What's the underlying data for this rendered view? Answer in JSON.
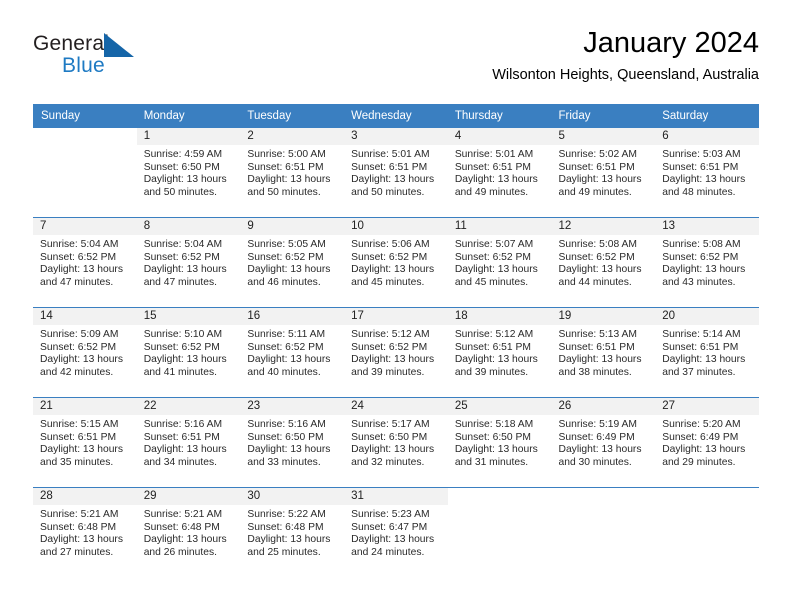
{
  "logo": {
    "word_one": "General",
    "word_two": "Blue",
    "flag_icon": "blue-triangle-flag-icon",
    "brand_blue": "#1e7ac3",
    "brand_dark": "#231f20"
  },
  "header": {
    "month_title": "January 2024",
    "location": "Wilsonton Heights, Queensland, Australia"
  },
  "theme": {
    "header_blue": "#3a7fc1",
    "daynum_band": "#f2f2f2",
    "text": "#000000"
  },
  "calendar": {
    "weekday_headers": [
      "Sunday",
      "Monday",
      "Tuesday",
      "Wednesday",
      "Thursday",
      "Friday",
      "Saturday"
    ],
    "weeks": [
      [
        {
          "day": "",
          "blank": true,
          "lines": []
        },
        {
          "day": "1",
          "lines": [
            "Sunrise: 4:59 AM",
            "Sunset: 6:50 PM",
            "Daylight: 13 hours",
            "and 50 minutes."
          ]
        },
        {
          "day": "2",
          "lines": [
            "Sunrise: 5:00 AM",
            "Sunset: 6:51 PM",
            "Daylight: 13 hours",
            "and 50 minutes."
          ]
        },
        {
          "day": "3",
          "lines": [
            "Sunrise: 5:01 AM",
            "Sunset: 6:51 PM",
            "Daylight: 13 hours",
            "and 50 minutes."
          ]
        },
        {
          "day": "4",
          "lines": [
            "Sunrise: 5:01 AM",
            "Sunset: 6:51 PM",
            "Daylight: 13 hours",
            "and 49 minutes."
          ]
        },
        {
          "day": "5",
          "lines": [
            "Sunrise: 5:02 AM",
            "Sunset: 6:51 PM",
            "Daylight: 13 hours",
            "and 49 minutes."
          ]
        },
        {
          "day": "6",
          "lines": [
            "Sunrise: 5:03 AM",
            "Sunset: 6:51 PM",
            "Daylight: 13 hours",
            "and 48 minutes."
          ]
        }
      ],
      [
        {
          "day": "7",
          "lines": [
            "Sunrise: 5:04 AM",
            "Sunset: 6:52 PM",
            "Daylight: 13 hours",
            "and 47 minutes."
          ]
        },
        {
          "day": "8",
          "lines": [
            "Sunrise: 5:04 AM",
            "Sunset: 6:52 PM",
            "Daylight: 13 hours",
            "and 47 minutes."
          ]
        },
        {
          "day": "9",
          "lines": [
            "Sunrise: 5:05 AM",
            "Sunset: 6:52 PM",
            "Daylight: 13 hours",
            "and 46 minutes."
          ]
        },
        {
          "day": "10",
          "lines": [
            "Sunrise: 5:06 AM",
            "Sunset: 6:52 PM",
            "Daylight: 13 hours",
            "and 45 minutes."
          ]
        },
        {
          "day": "11",
          "lines": [
            "Sunrise: 5:07 AM",
            "Sunset: 6:52 PM",
            "Daylight: 13 hours",
            "and 45 minutes."
          ]
        },
        {
          "day": "12",
          "lines": [
            "Sunrise: 5:08 AM",
            "Sunset: 6:52 PM",
            "Daylight: 13 hours",
            "and 44 minutes."
          ]
        },
        {
          "day": "13",
          "lines": [
            "Sunrise: 5:08 AM",
            "Sunset: 6:52 PM",
            "Daylight: 13 hours",
            "and 43 minutes."
          ]
        }
      ],
      [
        {
          "day": "14",
          "lines": [
            "Sunrise: 5:09 AM",
            "Sunset: 6:52 PM",
            "Daylight: 13 hours",
            "and 42 minutes."
          ]
        },
        {
          "day": "15",
          "lines": [
            "Sunrise: 5:10 AM",
            "Sunset: 6:52 PM",
            "Daylight: 13 hours",
            "and 41 minutes."
          ]
        },
        {
          "day": "16",
          "lines": [
            "Sunrise: 5:11 AM",
            "Sunset: 6:52 PM",
            "Daylight: 13 hours",
            "and 40 minutes."
          ]
        },
        {
          "day": "17",
          "lines": [
            "Sunrise: 5:12 AM",
            "Sunset: 6:52 PM",
            "Daylight: 13 hours",
            "and 39 minutes."
          ]
        },
        {
          "day": "18",
          "lines": [
            "Sunrise: 5:12 AM",
            "Sunset: 6:51 PM",
            "Daylight: 13 hours",
            "and 39 minutes."
          ]
        },
        {
          "day": "19",
          "lines": [
            "Sunrise: 5:13 AM",
            "Sunset: 6:51 PM",
            "Daylight: 13 hours",
            "and 38 minutes."
          ]
        },
        {
          "day": "20",
          "lines": [
            "Sunrise: 5:14 AM",
            "Sunset: 6:51 PM",
            "Daylight: 13 hours",
            "and 37 minutes."
          ]
        }
      ],
      [
        {
          "day": "21",
          "lines": [
            "Sunrise: 5:15 AM",
            "Sunset: 6:51 PM",
            "Daylight: 13 hours",
            "and 35 minutes."
          ]
        },
        {
          "day": "22",
          "lines": [
            "Sunrise: 5:16 AM",
            "Sunset: 6:51 PM",
            "Daylight: 13 hours",
            "and 34 minutes."
          ]
        },
        {
          "day": "23",
          "lines": [
            "Sunrise: 5:16 AM",
            "Sunset: 6:50 PM",
            "Daylight: 13 hours",
            "and 33 minutes."
          ]
        },
        {
          "day": "24",
          "lines": [
            "Sunrise: 5:17 AM",
            "Sunset: 6:50 PM",
            "Daylight: 13 hours",
            "and 32 minutes."
          ]
        },
        {
          "day": "25",
          "lines": [
            "Sunrise: 5:18 AM",
            "Sunset: 6:50 PM",
            "Daylight: 13 hours",
            "and 31 minutes."
          ]
        },
        {
          "day": "26",
          "lines": [
            "Sunrise: 5:19 AM",
            "Sunset: 6:49 PM",
            "Daylight: 13 hours",
            "and 30 minutes."
          ]
        },
        {
          "day": "27",
          "lines": [
            "Sunrise: 5:20 AM",
            "Sunset: 6:49 PM",
            "Daylight: 13 hours",
            "and 29 minutes."
          ]
        }
      ],
      [
        {
          "day": "28",
          "lines": [
            "Sunrise: 5:21 AM",
            "Sunset: 6:48 PM",
            "Daylight: 13 hours",
            "and 27 minutes."
          ]
        },
        {
          "day": "29",
          "lines": [
            "Sunrise: 5:21 AM",
            "Sunset: 6:48 PM",
            "Daylight: 13 hours",
            "and 26 minutes."
          ]
        },
        {
          "day": "30",
          "lines": [
            "Sunrise: 5:22 AM",
            "Sunset: 6:48 PM",
            "Daylight: 13 hours",
            "and 25 minutes."
          ]
        },
        {
          "day": "31",
          "lines": [
            "Sunrise: 5:23 AM",
            "Sunset: 6:47 PM",
            "Daylight: 13 hours",
            "and 24 minutes."
          ]
        },
        {
          "day": "",
          "blank": true,
          "lines": []
        },
        {
          "day": "",
          "blank": true,
          "lines": []
        },
        {
          "day": "",
          "blank": true,
          "lines": []
        }
      ]
    ]
  }
}
